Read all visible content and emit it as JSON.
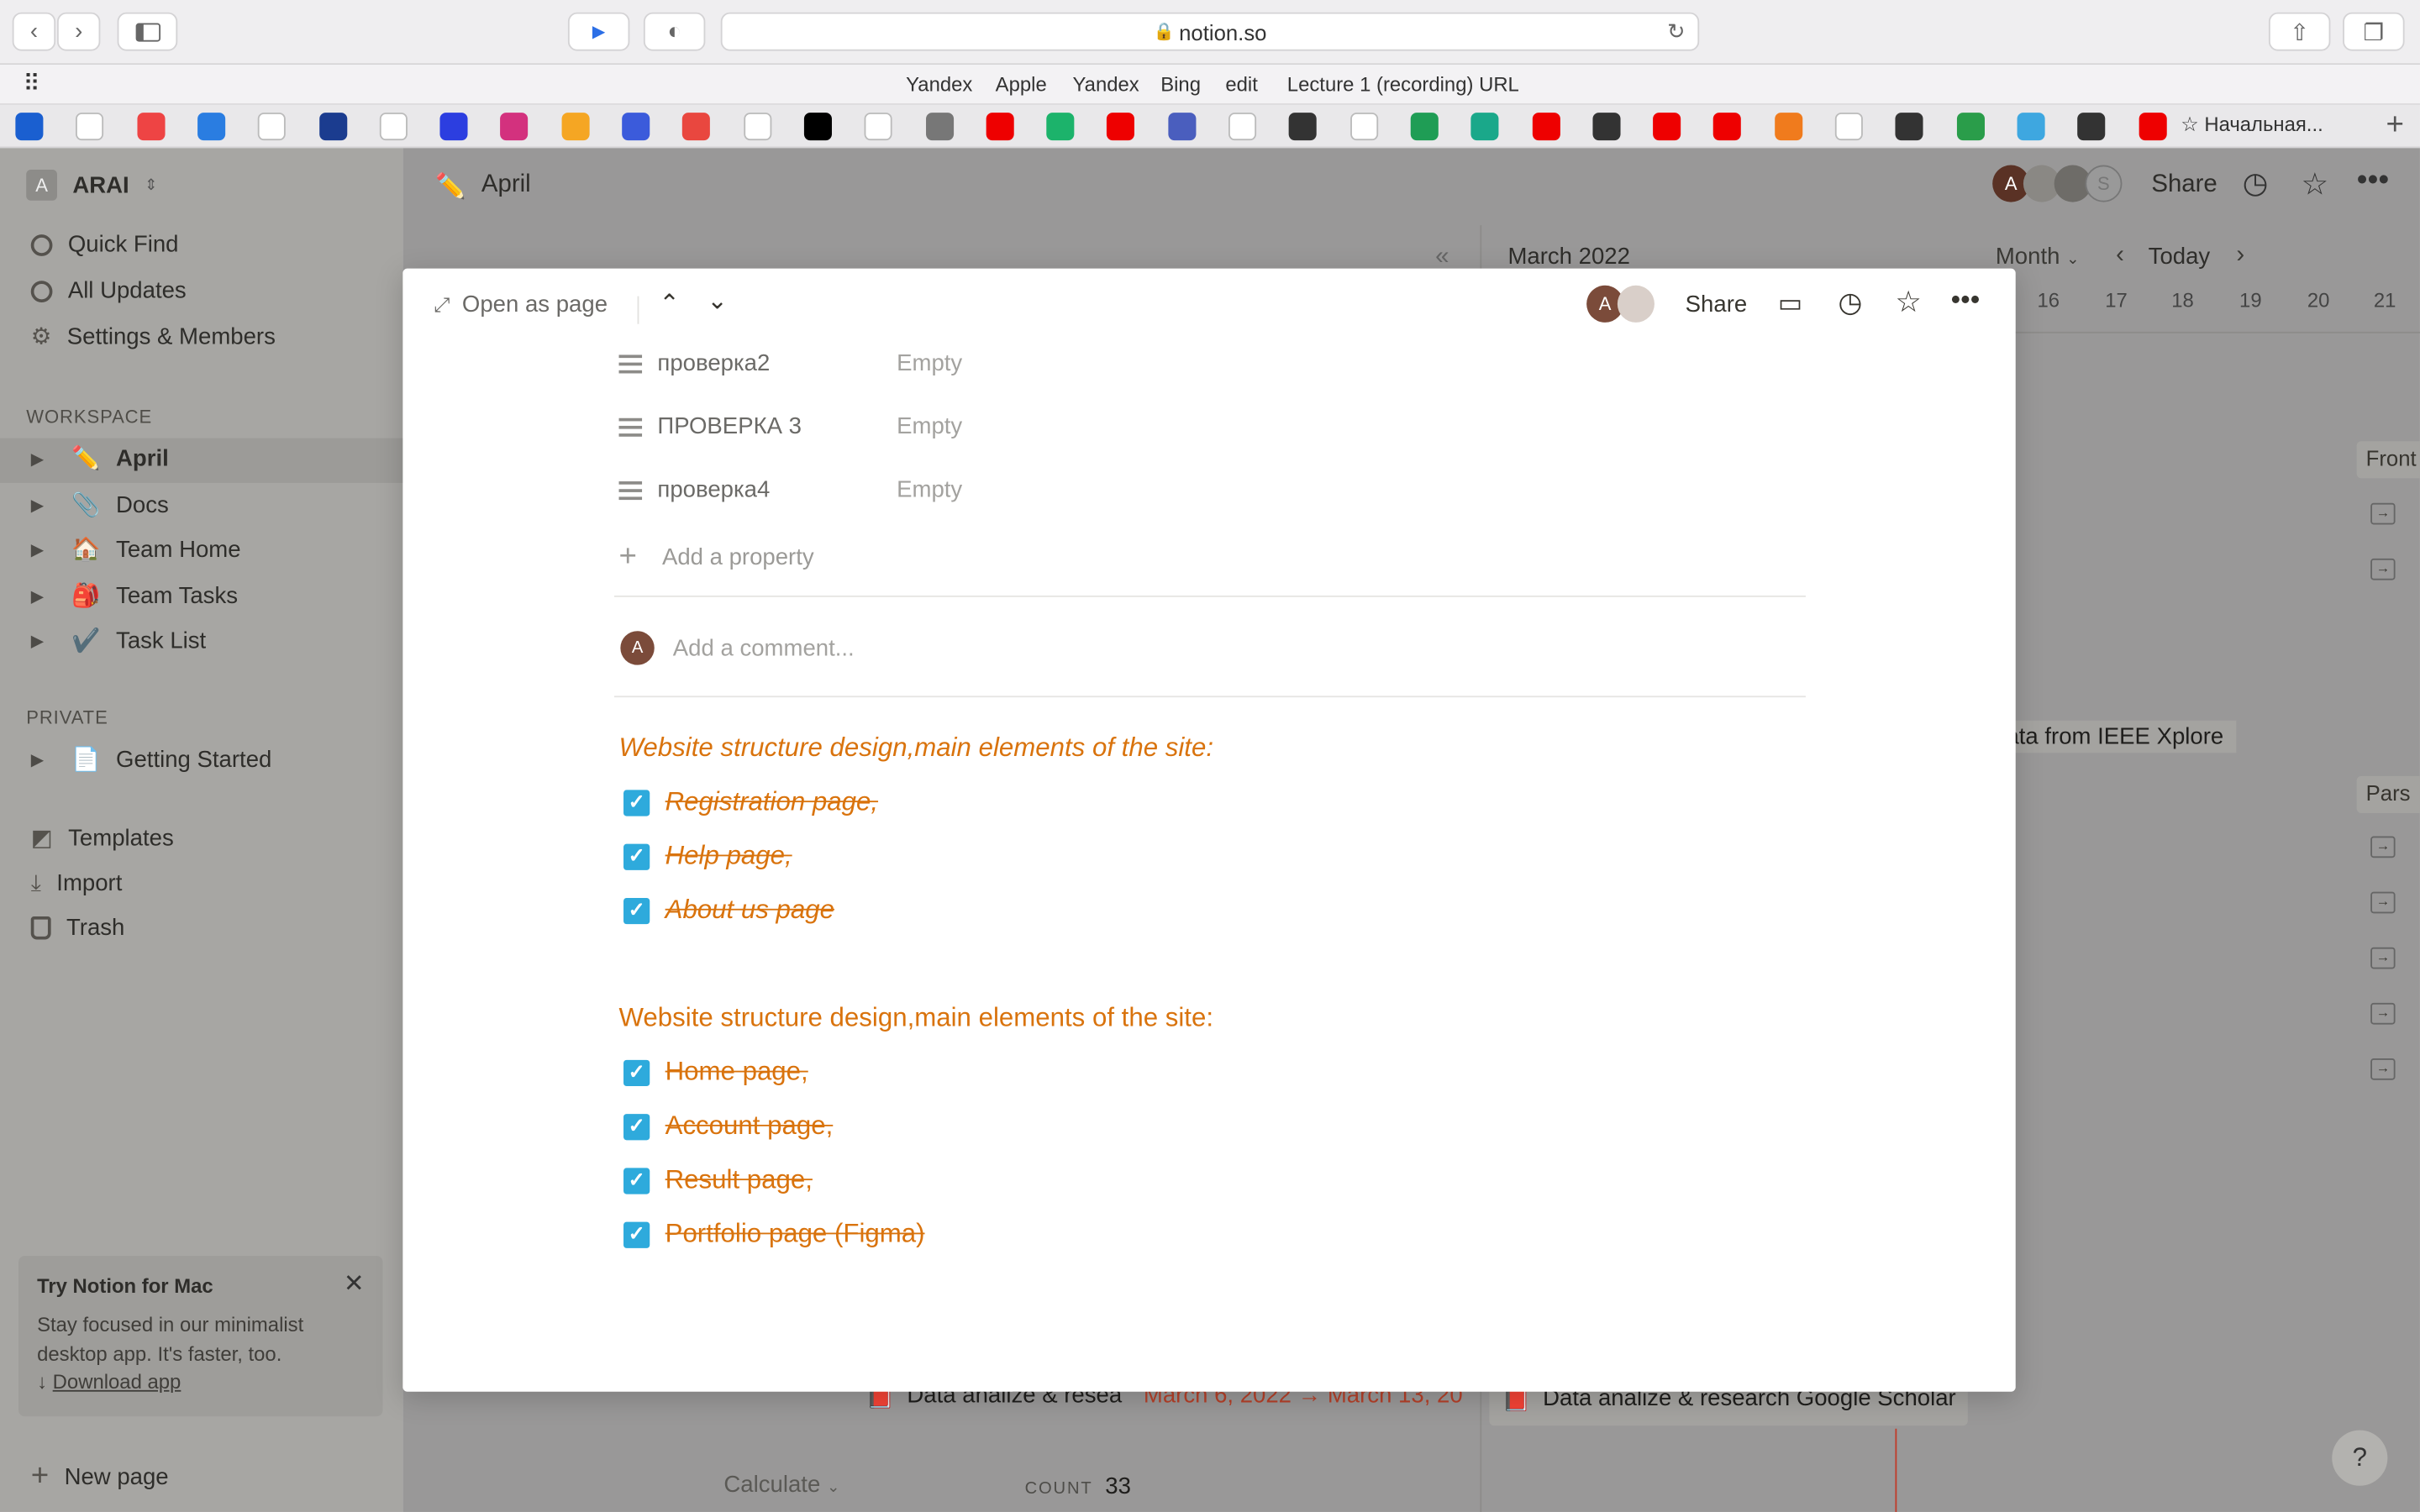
{
  "browser": {
    "url": "notion.so",
    "favorites": [
      "Yandex",
      "Apple",
      "Yandex",
      "Bing",
      "edit",
      "Lecture 1 (recording) URL"
    ],
    "last_tab_label": "Начальная..."
  },
  "sidebar": {
    "workspace_name": "ARAI",
    "workspace_initial": "A",
    "top_items": [
      {
        "label": "Quick Find",
        "icon": "search-icon"
      },
      {
        "label": "All Updates",
        "icon": "clock-icon"
      },
      {
        "label": "Settings & Members",
        "icon": "gear-icon"
      }
    ],
    "workspace_header": "WORKSPACE",
    "workspace_items": [
      {
        "label": "April",
        "icon": "✏️"
      },
      {
        "label": "Docs",
        "icon": "📎"
      },
      {
        "label": "Team Home",
        "icon": "🏠"
      },
      {
        "label": "Team Tasks",
        "icon": "🎒"
      },
      {
        "label": "Task List",
        "icon": "✔️"
      }
    ],
    "private_header": "PRIVATE",
    "private_items": [
      {
        "label": "Getting Started",
        "icon": "📄"
      }
    ],
    "bottom_items": [
      {
        "label": "Templates",
        "icon": "templates-icon"
      },
      {
        "label": "Import",
        "icon": "download-icon"
      },
      {
        "label": "Trash",
        "icon": "trash-icon"
      }
    ],
    "promo": {
      "title": "Try Notion for Mac",
      "body": "Stay focused in our minimalist desktop app. It's faster, too.",
      "link": "Download app"
    },
    "new_page": "New page"
  },
  "topbar": {
    "page_icon": "✏️",
    "page_title": "April",
    "share": "Share",
    "avatars": [
      "A",
      "S"
    ]
  },
  "calendar": {
    "month": "March 2022",
    "view": "Month",
    "today": "Today",
    "days": [
      "16",
      "17",
      "18",
      "19",
      "20",
      "21"
    ],
    "cards": [
      "Front",
      "g data from IEEE Xplore",
      "Pars"
    ],
    "bottom_card": "Data analize & research Google Scholar"
  },
  "table": {
    "row_title": "Data analize & resea",
    "row_date": "March 6, 2022 → March 13, 20",
    "calculate": "Calculate",
    "count_label": "COUNT",
    "count_value": "33"
  },
  "modal": {
    "open_as_page": "Open as page",
    "share": "Share",
    "avatar_initial": "A",
    "properties": [
      {
        "name": "проверка2",
        "value": "Empty"
      },
      {
        "name": "ПРОВЕРКА 3",
        "value": "Empty"
      },
      {
        "name": "проверка4",
        "value": "Empty"
      }
    ],
    "add_property": "Add a property",
    "comment_placeholder": "Add a comment...",
    "section1_title": "Website structure design,main elements of the site:",
    "section1_items": [
      "Registration page,",
      "Help page,",
      "About us page"
    ],
    "section2_title": "Website structure design,main elements of the site:",
    "section2_items": [
      "Home page,",
      "Account page,",
      "Result page,",
      "Portfolio page (Figma)"
    ]
  },
  "colors": {
    "accent_orange": "#d9730d",
    "checkbox_blue": "#2eaadc"
  }
}
